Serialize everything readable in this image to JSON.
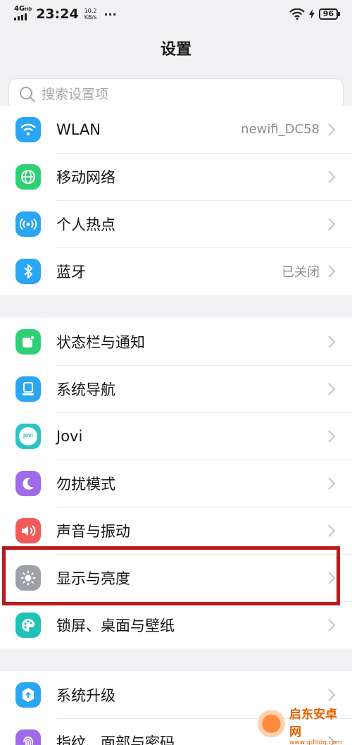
{
  "status_bar": {
    "network": "4G",
    "network_sup": "HD",
    "time": "23:24",
    "speed_value": "10.2",
    "speed_unit": "KB/s",
    "more": "···",
    "battery": "96"
  },
  "header": {
    "title": "设置"
  },
  "search": {
    "placeholder": "搜索设置项"
  },
  "groups": [
    {
      "items": [
        {
          "label": "WLAN",
          "value": "newifi_DC58",
          "icon": "wifi-icon",
          "color": "#2aa6f2"
        },
        {
          "label": "移动网络",
          "value": "",
          "icon": "globe-icon",
          "color": "#2fcf75"
        },
        {
          "label": "个人热点",
          "value": "",
          "icon": "hotspot-icon",
          "color": "#2aa6f2"
        },
        {
          "label": "蓝牙",
          "value": "已关闭",
          "icon": "bluetooth-icon",
          "color": "#2aa6f2"
        }
      ]
    },
    {
      "items": [
        {
          "label": "状态栏与通知",
          "value": "",
          "icon": "notification-icon",
          "color": "#2fcf75"
        },
        {
          "label": "系统导航",
          "value": "",
          "icon": "navigation-icon",
          "color": "#2aa6f2"
        },
        {
          "label": "Jovi",
          "value": "",
          "icon": "jovi-icon",
          "color": "#2ac4c7",
          "badge": "JOVI"
        },
        {
          "label": "勿扰模式",
          "value": "",
          "icon": "moon-icon",
          "color": "#a06be8"
        },
        {
          "label": "声音与振动",
          "value": "",
          "icon": "speaker-icon",
          "color": "#f25a5a"
        },
        {
          "label": "显示与亮度",
          "value": "",
          "icon": "brightness-icon",
          "color": "#9ea0a8"
        },
        {
          "label": "锁屏、桌面与壁纸",
          "value": "",
          "icon": "palette-icon",
          "color": "#20c2b8"
        }
      ]
    },
    {
      "items": [
        {
          "label": "系统升级",
          "value": "",
          "icon": "system-update-icon",
          "color": "#2aa6f2"
        },
        {
          "label": "指纹、面部与密码",
          "value": "",
          "icon": "fingerprint-icon",
          "color": "#a06be8"
        }
      ]
    }
  ],
  "watermark": {
    "name": "启东安卓网",
    "url": "www.qdltdq.com"
  }
}
